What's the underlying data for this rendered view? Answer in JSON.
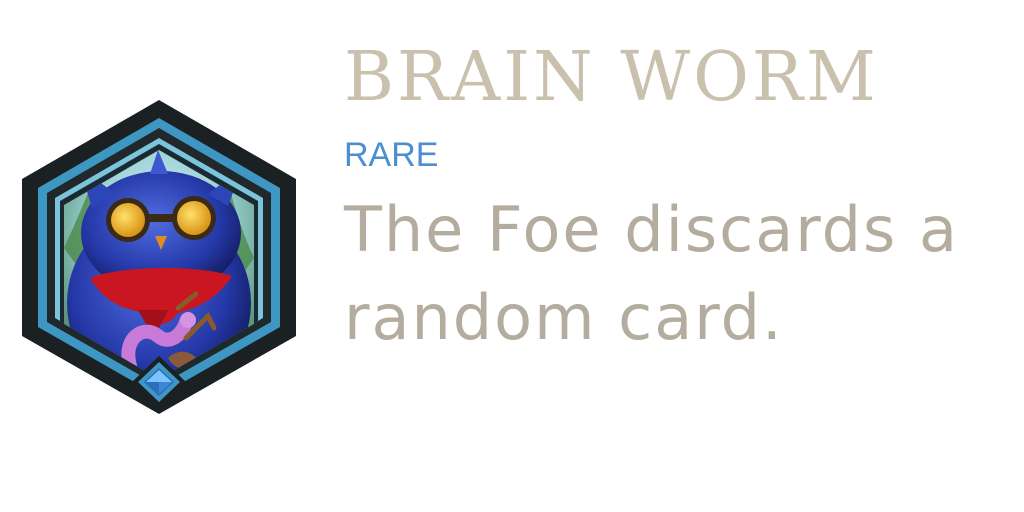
{
  "card": {
    "title": "BRAIN WORM",
    "rarity": "RARE",
    "description": "The Foe discards a random card.",
    "icon": "blue-owl-creature-portrait",
    "gem_icon": "blue-diamond-gem",
    "colors": {
      "title": "#c9c1ad",
      "rarity": "#4c8ed0",
      "description": "#b4ad9f",
      "frame_dark": "#1c2224",
      "frame_blue": "#3f98c2",
      "gem": "#5aa8f0"
    }
  }
}
